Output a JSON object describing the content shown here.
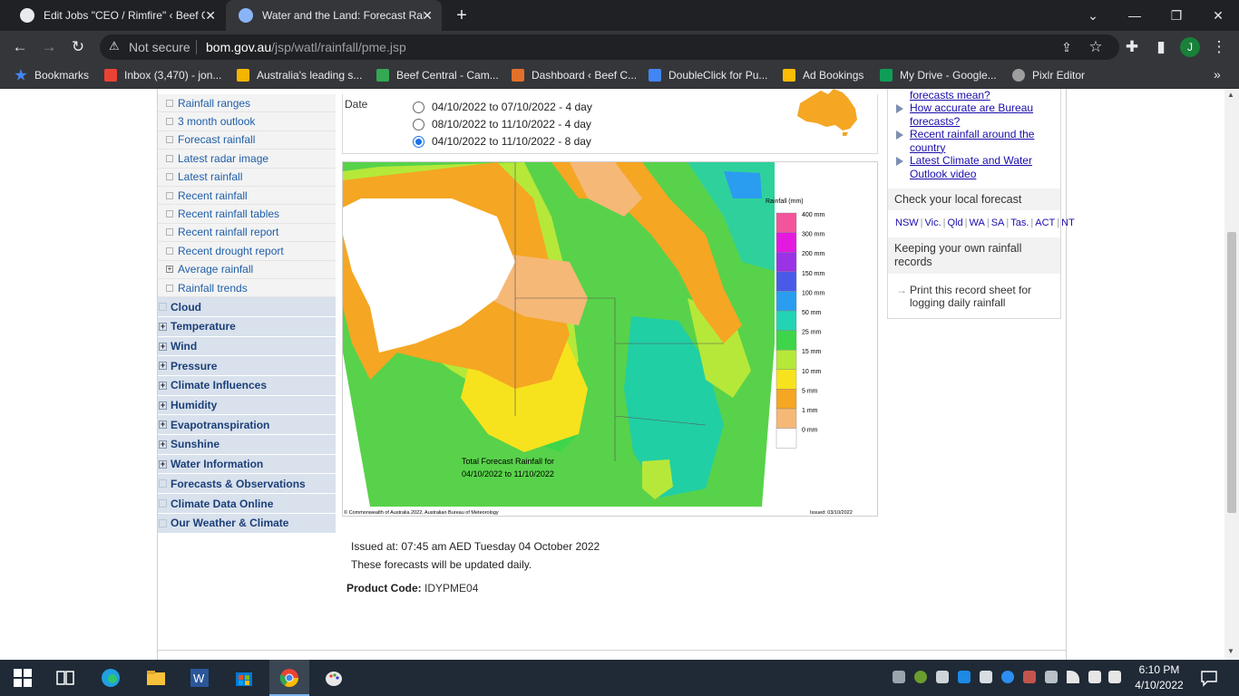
{
  "browser": {
    "tabs": [
      {
        "title": "Edit Jobs \"CEO / Rimfire\" ‹ Beef C",
        "active": false
      },
      {
        "title": "Water and the Land: Forecast Rai",
        "active": true
      }
    ],
    "new_tab": "+",
    "window_controls": [
      "⌄",
      "—",
      "❐",
      "✕"
    ],
    "security_label": "Not secure",
    "url_host": "bom.gov.au",
    "url_path": "/jsp/watl/rainfall/pme.jsp",
    "profile_initial": "J",
    "bookmarks": [
      {
        "label": "Bookmarks",
        "icon": "star-icon",
        "color": "#4285f4"
      },
      {
        "label": "Inbox (3,470) - jon...",
        "icon": "gmail-icon",
        "color": "#ea4335"
      },
      {
        "label": "Australia's leading s...",
        "icon": "seek-icon",
        "color": "#f4b400"
      },
      {
        "label": "Beef Central - Cam...",
        "icon": "beef-central-icon",
        "color": "#34a853"
      },
      {
        "label": "Dashboard ‹ Beef C...",
        "icon": "elementor-icon",
        "color": "#e2702a"
      },
      {
        "label": "DoubleClick for Pu...",
        "icon": "doubleclick-icon",
        "color": "#4285f4"
      },
      {
        "label": "Ad Bookings",
        "icon": "google-drive-icon",
        "color": "#fbbc05"
      },
      {
        "label": "My Drive - Google...",
        "icon": "google-drive-icon",
        "color": "#0f9d58"
      },
      {
        "label": "Pixlr Editor",
        "icon": "pixlr-icon",
        "color": "#9e9e9e"
      }
    ],
    "bookmarks_overflow": "»"
  },
  "leftnav": {
    "subitems": [
      {
        "label": "Rainfall ranges",
        "expandable": false
      },
      {
        "label": "3 month outlook",
        "expandable": false
      },
      {
        "label": "Forecast rainfall",
        "expandable": false
      },
      {
        "label": "Latest radar image",
        "expandable": false
      },
      {
        "label": "Latest rainfall",
        "expandable": false
      },
      {
        "label": "Recent rainfall",
        "expandable": false
      },
      {
        "label": "Recent rainfall tables",
        "expandable": false
      },
      {
        "label": "Recent rainfall report",
        "expandable": false
      },
      {
        "label": "Recent drought report",
        "expandable": false
      },
      {
        "label": "Average rainfall",
        "expandable": true
      },
      {
        "label": "Rainfall trends",
        "expandable": false
      }
    ],
    "topitems": [
      {
        "label": "Cloud",
        "expandable": false
      },
      {
        "label": "Temperature",
        "expandable": true
      },
      {
        "label": "Wind",
        "expandable": true
      },
      {
        "label": "Pressure",
        "expandable": true
      },
      {
        "label": "Climate Influences",
        "expandable": true
      },
      {
        "label": "Humidity",
        "expandable": true
      },
      {
        "label": "Evapotranspiration",
        "expandable": true
      },
      {
        "label": "Sunshine",
        "expandable": true
      },
      {
        "label": "Water Information",
        "expandable": true
      },
      {
        "label": "Forecasts & Observations",
        "expandable": false
      },
      {
        "label": "Climate Data Online",
        "expandable": false
      },
      {
        "label": "Our Weather & Climate",
        "expandable": false
      }
    ]
  },
  "date_selector": {
    "label": "Date",
    "options": [
      {
        "label": "04/10/2022 to 07/10/2022 - 4 day",
        "selected": false
      },
      {
        "label": "08/10/2022 to 11/10/2022 - 4 day",
        "selected": false
      },
      {
        "label": "04/10/2022 to 11/10/2022 - 8 day",
        "selected": true
      }
    ]
  },
  "map": {
    "legend_title": "Rainfall (mm)",
    "legend": [
      {
        "label": "400 mm",
        "color": "#f4549c"
      },
      {
        "label": "300 mm",
        "color": "#e419e0"
      },
      {
        "label": "200 mm",
        "color": "#9a32e6"
      },
      {
        "label": "150 mm",
        "color": "#4a5ae8"
      },
      {
        "label": "100 mm",
        "color": "#2a9df0"
      },
      {
        "label": "50 mm",
        "color": "#22d4b4"
      },
      {
        "label": "25 mm",
        "color": "#3ed54a"
      },
      {
        "label": "15 mm",
        "color": "#b6e83a"
      },
      {
        "label": "10 mm",
        "color": "#f6e31d"
      },
      {
        "label": "5 mm",
        "color": "#f5a623"
      },
      {
        "label": "1 mm",
        "color": "#f5b877"
      },
      {
        "label": "0 mm",
        "color": "#ffffff"
      }
    ],
    "caption_line1": "Total Forecast Rainfall for",
    "caption_line2": "04/10/2022 to 11/10/2022",
    "copyright": "© Commonwealth of Australia 2022, Australian Bureau of Meteorology",
    "issued_small": "Issued: 03/10/2022"
  },
  "issued_text": "Issued at: 07:45 am AED Tuesday 04 October 2022",
  "updated_text": "These forecasts will be updated daily.",
  "product_label": "Product Code:",
  "product_code": "IDYPME04",
  "rightcol": {
    "links": [
      "forecasts mean?",
      "How accurate are Bureau forecasts?",
      "Recent rainfall around the country",
      "Latest Climate and Water Outlook video"
    ],
    "check_heading": "Check your local forecast",
    "states": [
      "NSW",
      "Vic.",
      "Qld",
      "WA",
      "SA",
      "Tas.",
      "ACT",
      "NT"
    ],
    "records_heading": "Keeping your own rainfall records",
    "print_link": "Print this record sheet for logging daily rainfall"
  },
  "taskbar": {
    "time": "6:10 PM",
    "date": "4/10/2022"
  }
}
